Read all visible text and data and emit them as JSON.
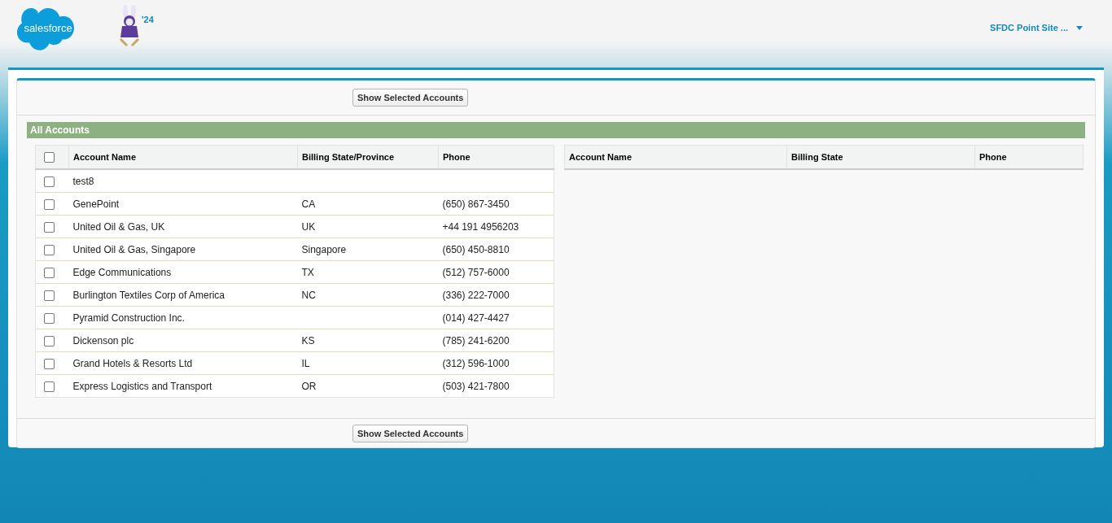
{
  "header": {
    "logo_text": "salesforce",
    "mascot_year": "'24",
    "user_menu": "SFDC Point Site ..."
  },
  "buttons": {
    "top": "Show Selected Accounts",
    "bottom": "Show Selected Accounts"
  },
  "section": {
    "title": "All Accounts"
  },
  "accounts_table": {
    "select_all_checked": false,
    "columns": [
      "Account Name",
      "Billing State/Province",
      "Phone"
    ],
    "rows": [
      {
        "name": "test8",
        "state": "",
        "phone": "",
        "checked": false
      },
      {
        "name": "GenePoint",
        "state": "CA",
        "phone": "(650) 867-3450",
        "checked": false
      },
      {
        "name": "United Oil & Gas, UK",
        "state": "UK",
        "phone": "+44 191 4956203",
        "checked": false
      },
      {
        "name": "United Oil & Gas, Singapore",
        "state": "Singapore",
        "phone": "(650) 450-8810",
        "checked": false
      },
      {
        "name": "Edge Communications",
        "state": "TX",
        "phone": "(512) 757-6000",
        "checked": false
      },
      {
        "name": "Burlington Textiles Corp of America",
        "state": "NC",
        "phone": "(336) 222-7000",
        "checked": false
      },
      {
        "name": "Pyramid Construction Inc.",
        "state": "",
        "phone": "(014) 427-4427",
        "checked": false
      },
      {
        "name": "Dickenson plc",
        "state": "KS",
        "phone": "(785) 241-6200",
        "checked": false
      },
      {
        "name": "Grand Hotels & Resorts Ltd",
        "state": "IL",
        "phone": "(312) 596-1000",
        "checked": false
      },
      {
        "name": "Express Logistics and Transport",
        "state": "OR",
        "phone": "(503) 421-7800",
        "checked": false
      }
    ]
  },
  "selected_table": {
    "columns": [
      "Account Name",
      "Billing State",
      "Phone"
    ]
  }
}
